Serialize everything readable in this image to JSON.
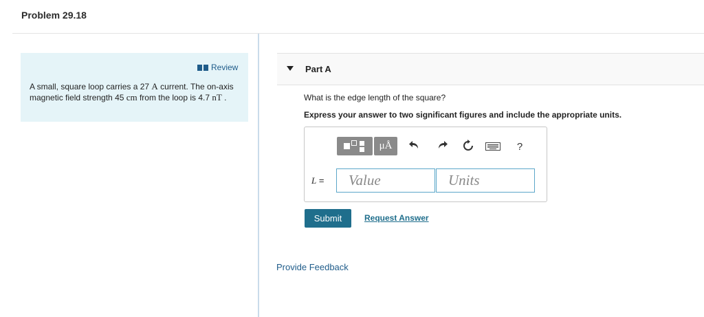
{
  "page": {
    "title": "Problem 29.18"
  },
  "review": {
    "label": "Review",
    "icon": "book-icon"
  },
  "problem": {
    "text_1": "A small, square loop carries a 27 ",
    "current_unit": "A",
    "text_2": " current. The on-axis magnetic field strength 45 ",
    "distance_unit": "cm",
    "text_3": " from the loop is 4.7 ",
    "field_unit": "nT",
    "text_4": " ."
  },
  "part": {
    "label": "Part A",
    "toggle_icon": "triangle-down-icon"
  },
  "question": "What is the edge length of the square?",
  "instruction": "Express your answer to two significant figures and include the appropriate units.",
  "toolbar": {
    "buttons": [
      {
        "name": "templates",
        "icon": "template-icon"
      },
      {
        "name": "units",
        "label": "μÅ"
      },
      {
        "name": "undo",
        "icon": "undo-icon"
      },
      {
        "name": "redo",
        "icon": "redo-icon"
      },
      {
        "name": "reset",
        "icon": "reset-icon"
      },
      {
        "name": "keyboard",
        "icon": "keyboard-icon"
      },
      {
        "name": "help",
        "label": "?"
      }
    ]
  },
  "answer": {
    "variable": "L",
    "equals": " =",
    "value_placeholder": "Value",
    "units_placeholder": "Units"
  },
  "actions": {
    "submit": "Submit",
    "request_answer": "Request Answer",
    "feedback": "Provide Feedback"
  },
  "colors": {
    "panel_bg": "#e5f4f8",
    "link": "#1f5c8a",
    "submit_bg": "#1f6e8c",
    "field_border": "#5aa6c9",
    "toolbar_btn": "#8a8a8a"
  }
}
